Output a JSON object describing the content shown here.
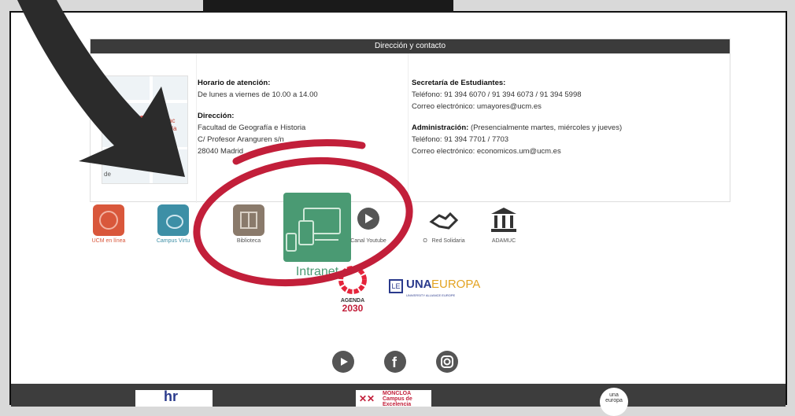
{
  "card": {
    "header": "Dirección y contacto",
    "map": {
      "label_a": "Am",
      "label_b": "pa",
      "label_c": "M: Fac",
      "label_d": "grafía",
      "label_e": "de"
    },
    "col1": {
      "horario_title": "Horario de atención:",
      "horario_value": "De lunes a viernes de 10.00 a 14.00",
      "direccion_title": "Dirección:",
      "direccion_l1": "Facultad de Geografía e Historia",
      "direccion_l2": "C/ Profesor Aranguren s/n",
      "direccion_l3": "28040 Madrid"
    },
    "col2": {
      "secretaria_title": "Secretaría de Estudiantes:",
      "secretaria_tel": "Teléfono: 91 394 6070 / 91 394 6073 / 91 394 5998",
      "secretaria_mail": "Correo electrónico: umayores@ucm.es",
      "admin_title": "Administración:",
      "admin_note": " (Presencialmente martes, miércoles y jueves)",
      "admin_tel": "Teléfono: 91 394 7701 / 7703",
      "admin_mail": "Correo electrónico: economicos.um@ucm.es"
    }
  },
  "icons": [
    {
      "label": "UCM en línea",
      "color": "#d9573b"
    },
    {
      "label": "Campus Virtu",
      "color": "#3d8fa6"
    },
    {
      "label": "Biblioteca",
      "color": "#8a7a6b"
    },
    {
      "label": "Canal Youtube",
      "color": "#555555"
    },
    {
      "label": "O",
      "color": "#333333"
    },
    {
      "label": "Red Solidaria",
      "color": "#333333"
    },
    {
      "label": "ADAMUC",
      "color": "#333333"
    }
  ],
  "intranet": {
    "label": "Intranet",
    "color": "#4a9a73"
  },
  "agenda": {
    "line1": "AGENDA",
    "line2": "2030"
  },
  "unaeuropa": {
    "text_una": "UNA",
    "text_europa": "EUROPA",
    "sub": "UNIVERSITY ALLIANCE EUROPE"
  },
  "footer": {
    "hr": "hr",
    "moncloa_l1": "MONCLOA",
    "moncloa_l2": "Campus de",
    "moncloa_l3": "Excelencia",
    "una_l1": "una",
    "una_l2": "europa"
  },
  "colors": {
    "annotation_red": "#c21f3a",
    "arrow": "#2b2b2b"
  }
}
